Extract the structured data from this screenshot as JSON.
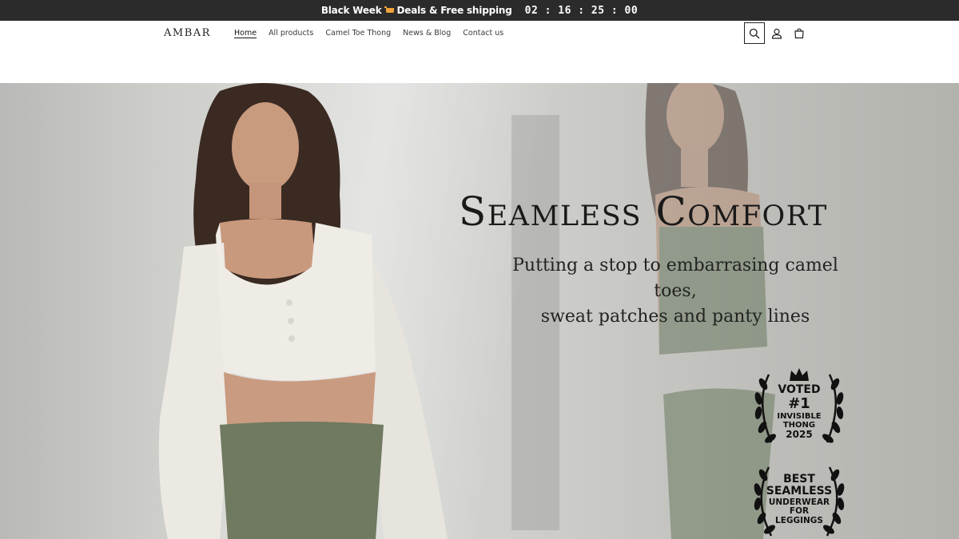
{
  "announcement": {
    "promo_before": "Black Week",
    "promo_after": "Deals & Free shipping",
    "promo_icon": "shopping-cart-emoji",
    "countdown": "02 : 16 : 25 : 00"
  },
  "header": {
    "logo": "AMBAR",
    "nav": [
      {
        "label": "Home",
        "active": true
      },
      {
        "label": "All products",
        "active": false
      },
      {
        "label": "Camel Toe Thong",
        "active": false
      },
      {
        "label": "News & Blog",
        "active": false
      },
      {
        "label": "Contact us",
        "active": false
      }
    ],
    "icons": [
      "search-icon",
      "account-icon",
      "cart-icon"
    ]
  },
  "hero": {
    "title": "Seamless Comfort",
    "subtitle_line1": "Putting a stop to embarrasing camel toes,",
    "subtitle_line2": "sweat patches and panty lines",
    "badges": [
      {
        "lines": [
          "VOTED",
          "#1",
          "INVISIBLE",
          "THONG",
          "2025"
        ],
        "icon": "crown-icon"
      },
      {
        "lines": [
          "BEST",
          "SEAMLESS",
          "UNDERWEAR",
          "FOR",
          "LEGGINGS"
        ]
      }
    ]
  },
  "colors": {
    "announcement_bg": "#2b2b2b",
    "text": "#121212",
    "hero_bg": "#cfcfcc"
  }
}
